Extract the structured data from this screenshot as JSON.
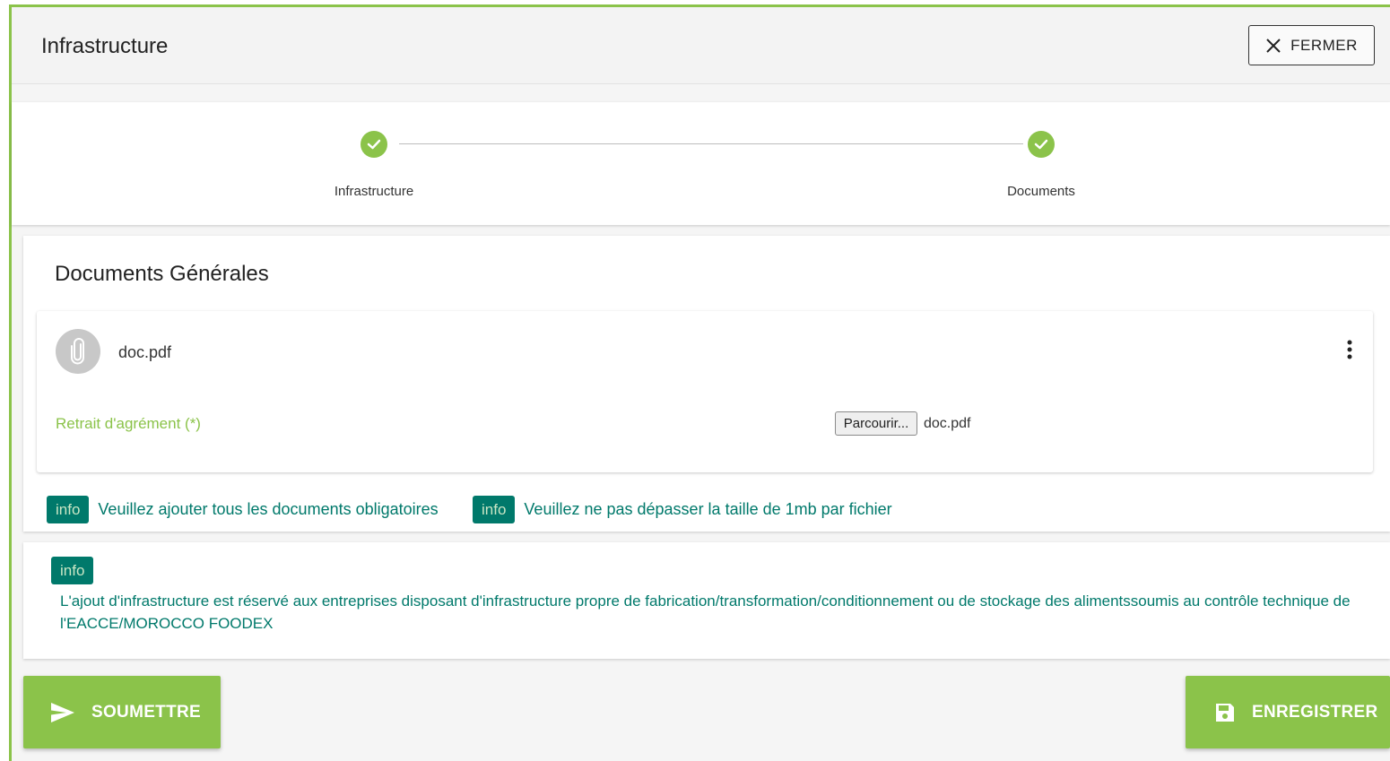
{
  "dialog": {
    "title": "Infrastructure",
    "close_label": "FERMER"
  },
  "stepper": {
    "steps": [
      {
        "label": "Infrastructure",
        "status": "complete"
      },
      {
        "label": "Documents",
        "status": "complete"
      }
    ]
  },
  "documents": {
    "section_title": "Documents Générales",
    "card": {
      "file_name": "doc.pdf",
      "field_label": "Retrait d'agrément (*)",
      "browse_label": "Parcourir...",
      "selected_file": "doc.pdf"
    },
    "infos": [
      {
        "badge": "info",
        "text": "Veuillez ajouter tous les documents obligatoires"
      },
      {
        "badge": "info",
        "text": "Veuillez ne pas dépasser la taille de 1mb par fichier"
      }
    ]
  },
  "notice": {
    "badge": "info",
    "text": "L'ajout d'infrastructure est réservé aux entreprises disposant d'infrastructure propre de fabrication/transformation/conditionnement ou de stockage des alimentssoumis au contrôle technique de l'EACCE/MOROCCO FOODEX"
  },
  "actions": {
    "submit_label": "SOUMETTRE",
    "save_label": "ENREGISTRER"
  },
  "colors": {
    "accent": "#8bc34a",
    "info": "#00796b"
  },
  "icons": {
    "close": "close-icon",
    "check": "check-icon",
    "attachment": "paperclip-icon",
    "more": "more-vertical-icon",
    "send": "send-icon",
    "save": "floppy-disk-icon"
  }
}
